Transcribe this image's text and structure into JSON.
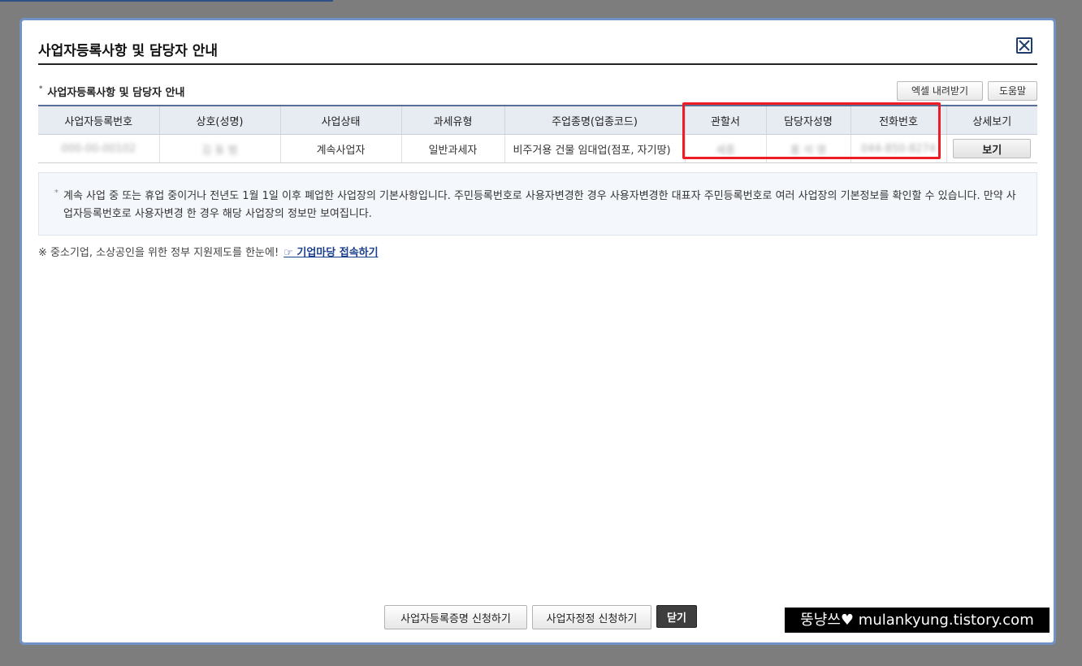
{
  "modal": {
    "title": "사업자등록사항 및 담당자 안내",
    "close_label": "close"
  },
  "section": {
    "bullet": "•",
    "title": "사업자등록사항 및 담당자 안내"
  },
  "toolbar": {
    "excel_label": "엑셀 내려받기",
    "help_label": "도움말"
  },
  "table": {
    "headers": [
      "사업자등록번호",
      "상호(성명)",
      "사업상태",
      "과세유형",
      "주업종명(업종코드)",
      "관할서",
      "담당자성명",
      "전화번호",
      "상세보기"
    ],
    "rows": [
      {
        "reg_no": "000-00-00102",
        "name": "김 동 범",
        "status": "계속사업자",
        "tax_type": "일반과세자",
        "industry": "비주거용 건물 임대업(점포, 자기땅)",
        "office": "세종",
        "manager": "홍 석 영",
        "phone": "044-850-8274",
        "view_label": "보기"
      }
    ]
  },
  "info": {
    "mark": "*",
    "text": "계속 사업 중 또는 휴업 중이거나 전년도 1월 1일 이후 폐업한 사업장의 기본사항입니다. 주민등록번호로 사용자변경한 경우 사용자변경한 대표자 주민등록번호로 여러 사업장의 기본정보를 확인할 수 있습니다. 만약 사업자등록번호로 사용자변경 한 경우 해당 사업장의 정보만 보여집니다."
  },
  "notice": {
    "text": "※ 중소기업, 소상공인을 위한 정부 지원제도를 한눈에!",
    "link": "☞ 기업마당 접속하기"
  },
  "footer": {
    "btn_cert": "사업자등록증명 신청하기",
    "btn_correct": "사업자정정 신청하기",
    "btn_close": "닫기"
  },
  "watermark": "뚱냥쓰♥ mulankyung.tistory.com",
  "colors": {
    "highlight": "#ee1d25",
    "header_bg": "#e7ebf2",
    "modal_border": "#6f93c6"
  }
}
